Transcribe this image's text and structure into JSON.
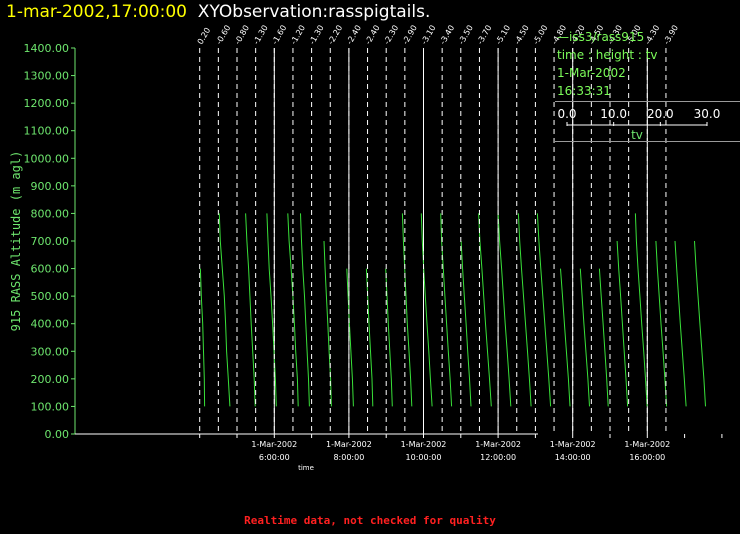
{
  "header": {
    "timestamp": "1-mar-2002,17:00:00",
    "observation": "XYObservation:rasspigtails."
  },
  "legend": {
    "series": "iss3/rass915",
    "vars": "time : height : tv",
    "date": "1-Mar-2002",
    "time": "16:33:31",
    "scale_ticks": [
      "0.0",
      "10.0",
      "20.0",
      "30.0"
    ],
    "scale_label": "tv"
  },
  "footer": {
    "note": "Realtime data, not checked for quality"
  },
  "colors": {
    "trace": "#39e039",
    "axis": "#6ee66e",
    "title_time": "#ffff00",
    "footer": "#ff2020"
  },
  "chart_data": {
    "type": "line",
    "title": "",
    "xlabel": "time",
    "ylabel": "915 RASS Altitude (m agl)",
    "xlim": [
      3.8,
      18.5
    ],
    "ylim": [
      0,
      1400
    ],
    "yticks": [
      0,
      100,
      200,
      300,
      400,
      500,
      600,
      700,
      800,
      900,
      1000,
      1100,
      1200,
      1300,
      1400
    ],
    "ytick_labels": [
      "0.00",
      "100.00",
      "200.00",
      "300.00",
      "400.00",
      "500.00",
      "600.00",
      "700.00",
      "800.00",
      "900.00",
      "1000.00",
      "1100.00",
      "1200.00",
      "1300.00",
      "1400.00"
    ],
    "xticks": [
      {
        "hour": 6,
        "date": "1-Mar-2002",
        "time": "6:00:00"
      },
      {
        "hour": 8,
        "date": "1-Mar-2002",
        "time": "8:00:00"
      },
      {
        "hour": 10,
        "date": "1-Mar-2002",
        "time": "10:00:00"
      },
      {
        "hour": 12,
        "date": "1-Mar-2002",
        "time": "12:00:00"
      },
      {
        "hour": 14,
        "date": "1-Mar-2002",
        "time": "14:00:00"
      },
      {
        "hour": 16,
        "date": "1-Mar-2002",
        "time": "16:00:00"
      }
    ],
    "altitudes": [
      100,
      200,
      300,
      400,
      500,
      600,
      700,
      800
    ],
    "profiles": [
      {
        "time": 4.0,
        "label": "0.20",
        "tv": [
          3.0,
          2.8,
          2.3,
          1.8,
          1.0,
          0.4,
          null,
          null
        ],
        "top_alt": 600
      },
      {
        "time": 4.5,
        "label": "-0.60",
        "tv": [
          7.0,
          6.0,
          5.0,
          4.4,
          3.6,
          2.4,
          1.2,
          0.6
        ],
        "top_alt": 780
      },
      {
        "time": 5.0,
        "label": "-0.80",
        "tv": [
          11.0,
          10.4,
          9.5,
          8.6,
          7.8,
          7.0,
          6.0,
          5.2
        ],
        "top_alt": 780
      },
      {
        "time": 5.5,
        "label": "-1.30",
        "tv": [
          12.5,
          12.0,
          11.1,
          10.3,
          9.3,
          8.2,
          7.5,
          6.8
        ],
        "top_alt": 780
      },
      {
        "time": 6.0,
        "label": "-1.60",
        "tv": [
          14.5,
          14.0,
          13.0,
          12.2,
          11.3,
          10.2,
          9.0,
          8.2
        ],
        "top_alt": 780
      },
      {
        "time": 6.5,
        "label": "-1.20",
        "tv": [
          10.0,
          9.4,
          8.6,
          7.8,
          7.0,
          6.0,
          5.2,
          4.6
        ],
        "top_alt": 780
      },
      {
        "time": 7.0,
        "label": "-1.30",
        "tv": [
          12.0,
          11.5,
          10.6,
          9.8,
          9.0,
          8.2,
          7.5,
          null
        ],
        "top_alt": 700
      },
      {
        "time": 7.5,
        "label": "-2.20",
        "tv": [
          14.0,
          13.4,
          12.5,
          11.6,
          10.8,
          10.0,
          null,
          null
        ],
        "top_alt": 600
      },
      {
        "time": 8.0,
        "label": "-2.40",
        "tv": [
          14.5,
          14.0,
          13.1,
          12.2,
          11.4,
          10.6,
          null,
          null
        ],
        "top_alt": 620
      },
      {
        "time": 8.5,
        "label": "-2.40",
        "tv": [
          15.0,
          14.4,
          13.5,
          12.6,
          11.8,
          11.0,
          null,
          null
        ],
        "top_alt": 600
      },
      {
        "time": 9.0,
        "label": "-2.30",
        "tv": [
          15.5,
          14.8,
          13.8,
          12.8,
          12.0,
          11.2,
          10.4,
          9.8
        ],
        "top_alt": 800
      },
      {
        "time": 9.5,
        "label": "-2.90",
        "tv": [
          16.5,
          15.5,
          14.5,
          13.4,
          12.4,
          11.4,
          10.6,
          10.0
        ],
        "top_alt": 780
      },
      {
        "time": 10.0,
        "label": "-3.10",
        "tv": [
          17.0,
          16.1,
          15.0,
          14.0,
          13.0,
          12.0,
          11.0,
          10.4
        ],
        "top_alt": 780
      },
      {
        "time": 10.5,
        "label": "-3.40",
        "tv": [
          17.5,
          16.6,
          15.5,
          14.5,
          13.4,
          12.4,
          11.5,
          null
        ],
        "top_alt": 680
      },
      {
        "time": 11.0,
        "label": "-3.50",
        "tv": [
          18.5,
          17.4,
          16.2,
          15.0,
          13.9,
          12.8,
          11.6,
          10.8
        ],
        "top_alt": 780
      },
      {
        "time": 11.5,
        "label": "-3.70",
        "tv": [
          19.0,
          18.0,
          16.8,
          15.6,
          14.5,
          13.4,
          12.2,
          11.3
        ],
        "top_alt": 780
      },
      {
        "time": 12.0,
        "label": "-5.10",
        "tv": [
          20.0,
          19.0,
          17.8,
          16.6,
          15.4,
          14.2,
          13.1,
          12.3
        ],
        "top_alt": 780
      },
      {
        "time": 12.5,
        "label": "-4.50",
        "tv": [
          20.5,
          19.4,
          18.2,
          17.0,
          15.8,
          14.6,
          13.4,
          12.5
        ],
        "top_alt": 780
      },
      {
        "time": 13.0,
        "label": "-5.00",
        "tv": [
          21.0,
          20.0,
          18.8,
          17.6,
          16.4,
          15.2,
          null,
          null
        ],
        "top_alt": 650
      },
      {
        "time": 13.5,
        "label": "-4.80",
        "tv": [
          21.5,
          20.5,
          19.3,
          18.1,
          17.0,
          15.9,
          null,
          null
        ],
        "top_alt": 600
      },
      {
        "time": 14.0,
        "label": "-4.20",
        "tv": [
          21.5,
          20.6,
          19.5,
          18.4,
          17.3,
          16.2,
          null,
          null
        ],
        "top_alt": 620
      },
      {
        "time": 14.5,
        "label": "-4.50",
        "tv": [
          22.0,
          21.0,
          19.9,
          18.8,
          17.7,
          16.6,
          15.6,
          null
        ],
        "top_alt": 720
      },
      {
        "time": 15.0,
        "label": "-4.30",
        "tv": [
          22.5,
          21.5,
          20.4,
          19.2,
          18.1,
          17.0,
          16.0,
          15.4
        ],
        "top_alt": 780
      },
      {
        "time": 15.5,
        "label": "-5.00",
        "tv": [
          23.0,
          22.0,
          20.8,
          19.6,
          18.5,
          17.4,
          16.5,
          null
        ],
        "top_alt": 720
      },
      {
        "time": 16.0,
        "label": "-4.30",
        "tv": [
          23.5,
          22.4,
          21.2,
          20.0,
          18.9,
          17.8,
          16.8,
          null
        ],
        "top_alt": 720
      },
      {
        "time": 16.5,
        "label": "-3.90",
        "tv": [
          24.0,
          23.0,
          21.8,
          20.6,
          19.4,
          18.3,
          17.3,
          null
        ],
        "top_alt": 700
      }
    ]
  }
}
